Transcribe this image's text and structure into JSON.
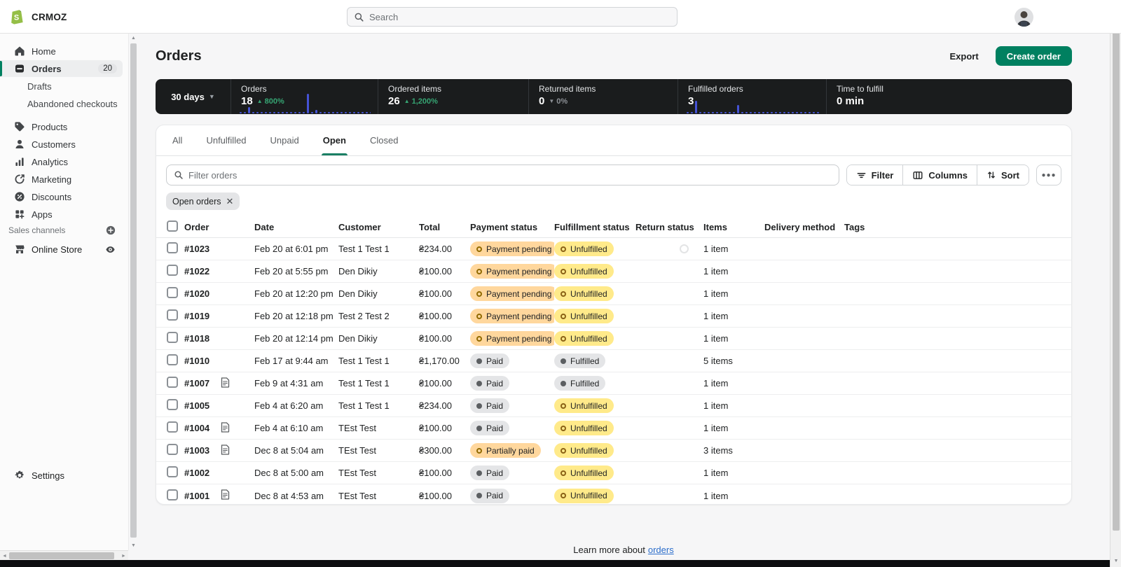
{
  "colors": {
    "accent_green": "#008060",
    "dark_panel": "#1a1c1d",
    "spark_blue": "#4553d6",
    "success_green": "#36a573",
    "link_blue": "#2c6ecb",
    "warning_bg": "#ffd79d",
    "attention_bg": "#ffea8a",
    "neutral_bg": "#e4e5e7"
  },
  "topbar": {
    "brand": "CRMOZ",
    "search_placeholder": "Search"
  },
  "sidebar": {
    "items": [
      {
        "label": "Home",
        "icon": "home-icon"
      },
      {
        "label": "Orders",
        "icon": "orders-icon",
        "badge": "20",
        "active": true
      },
      {
        "label": "Drafts",
        "indent": true
      },
      {
        "label": "Abandoned checkouts",
        "indent": true
      },
      {
        "label": "Products",
        "icon": "products-icon",
        "gap": true
      },
      {
        "label": "Customers",
        "icon": "customers-icon"
      },
      {
        "label": "Analytics",
        "icon": "analytics-icon"
      },
      {
        "label": "Marketing",
        "icon": "marketing-icon"
      },
      {
        "label": "Discounts",
        "icon": "discounts-icon"
      },
      {
        "label": "Apps",
        "icon": "apps-icon"
      }
    ],
    "sales_channels_label": "Sales channels",
    "online_store_label": "Online Store",
    "settings_label": "Settings"
  },
  "page": {
    "title": "Orders",
    "export_label": "Export",
    "create_order_label": "Create order",
    "footer_text": "Learn more about",
    "footer_link": "orders"
  },
  "stats": {
    "range": "30 days",
    "cards": [
      {
        "label": "Orders",
        "value": "18",
        "delta": "800%",
        "direction": "up",
        "spark": [
          2,
          2,
          9,
          2,
          2,
          2,
          2,
          2,
          2,
          2,
          2,
          2,
          2,
          2,
          2,
          2,
          28,
          2,
          5,
          2,
          2,
          2,
          2,
          2,
          2,
          2,
          2,
          2,
          2,
          2,
          2,
          2,
          2
        ]
      },
      {
        "label": "Ordered items",
        "value": "26",
        "delta": "1,200%",
        "direction": "up"
      },
      {
        "label": "Returned items",
        "value": "0",
        "delta": "0%",
        "direction": "down"
      },
      {
        "label": "Fulfilled orders",
        "value": "3",
        "spark": [
          2,
          2,
          18,
          2,
          2,
          2,
          2,
          2,
          2,
          2,
          2,
          2,
          12,
          2,
          2,
          2,
          2,
          2,
          2,
          2,
          2,
          2,
          2,
          2,
          2,
          2,
          2,
          2,
          2,
          2,
          2,
          2,
          2
        ]
      },
      {
        "label": "Time to fulfill",
        "value": "0 min"
      }
    ]
  },
  "tabs": {
    "items": [
      "All",
      "Unfulfilled",
      "Unpaid",
      "Open",
      "Closed"
    ],
    "active": "Open"
  },
  "toolbar": {
    "filter_placeholder": "Filter orders",
    "filter_label": "Filter",
    "columns_label": "Columns",
    "sort_label": "Sort",
    "chip_label": "Open orders"
  },
  "table": {
    "columns": [
      "Order",
      "Date",
      "Customer",
      "Total",
      "Payment status",
      "Fulfillment status",
      "Return status",
      "Items",
      "Delivery method",
      "Tags"
    ],
    "rows": [
      {
        "order": "#1023",
        "note": false,
        "date": "Feb 20 at 6:01 pm",
        "customer": "Test 1 Test 1",
        "total": "₴234.00",
        "payment": "Payment pending",
        "payment_type": "pending",
        "fulfillment": "Unfulfilled",
        "fulfillment_type": "unfulfilled",
        "items": "1 item",
        "spinner": true
      },
      {
        "order": "#1022",
        "note": false,
        "date": "Feb 20 at 5:55 pm",
        "customer": "Den Dikiy",
        "total": "₴100.00",
        "payment": "Payment pending",
        "payment_type": "pending",
        "fulfillment": "Unfulfilled",
        "fulfillment_type": "unfulfilled",
        "items": "1 item"
      },
      {
        "order": "#1020",
        "note": false,
        "date": "Feb 20 at 12:20 pm",
        "customer": "Den Dikiy",
        "total": "₴100.00",
        "payment": "Payment pending",
        "payment_type": "pending",
        "fulfillment": "Unfulfilled",
        "fulfillment_type": "unfulfilled",
        "items": "1 item"
      },
      {
        "order": "#1019",
        "note": false,
        "date": "Feb 20 at 12:18 pm",
        "customer": "Test 2 Test 2",
        "total": "₴100.00",
        "payment": "Payment pending",
        "payment_type": "pending",
        "fulfillment": "Unfulfilled",
        "fulfillment_type": "unfulfilled",
        "items": "1 item"
      },
      {
        "order": "#1018",
        "note": false,
        "date": "Feb 20 at 12:14 pm",
        "customer": "Den Dikiy",
        "total": "₴100.00",
        "payment": "Payment pending",
        "payment_type": "pending",
        "fulfillment": "Unfulfilled",
        "fulfillment_type": "unfulfilled",
        "items": "1 item"
      },
      {
        "order": "#1010",
        "note": false,
        "date": "Feb 17 at 9:44 am",
        "customer": "Test 1 Test 1",
        "total": "₴1,170.00",
        "payment": "Paid",
        "payment_type": "paid",
        "fulfillment": "Fulfilled",
        "fulfillment_type": "fulfilled",
        "items": "5 items"
      },
      {
        "order": "#1007",
        "note": true,
        "date": "Feb 9 at 4:31 am",
        "customer": "Test 1 Test 1",
        "total": "₴100.00",
        "payment": "Paid",
        "payment_type": "paid",
        "fulfillment": "Fulfilled",
        "fulfillment_type": "fulfilled",
        "items": "1 item"
      },
      {
        "order": "#1005",
        "note": false,
        "date": "Feb 4 at 6:20 am",
        "customer": "Test 1 Test 1",
        "total": "₴234.00",
        "payment": "Paid",
        "payment_type": "paid",
        "fulfillment": "Unfulfilled",
        "fulfillment_type": "unfulfilled",
        "items": "1 item"
      },
      {
        "order": "#1004",
        "note": true,
        "date": "Feb 4 at 6:10 am",
        "customer": "TEst Test",
        "total": "₴100.00",
        "payment": "Paid",
        "payment_type": "paid",
        "fulfillment": "Unfulfilled",
        "fulfillment_type": "unfulfilled",
        "items": "1 item"
      },
      {
        "order": "#1003",
        "note": true,
        "date": "Dec 8 at 5:04 am",
        "customer": "TEst Test",
        "total": "₴300.00",
        "payment": "Partially paid",
        "payment_type": "partial",
        "fulfillment": "Unfulfilled",
        "fulfillment_type": "unfulfilled",
        "items": "3 items"
      },
      {
        "order": "#1002",
        "note": false,
        "date": "Dec 8 at 5:00 am",
        "customer": "TEst Test",
        "total": "₴100.00",
        "payment": "Paid",
        "payment_type": "paid",
        "fulfillment": "Unfulfilled",
        "fulfillment_type": "unfulfilled",
        "items": "1 item"
      },
      {
        "order": "#1001",
        "note": true,
        "date": "Dec 8 at 4:53 am",
        "customer": "TEst Test",
        "total": "₴100.00",
        "payment": "Paid",
        "payment_type": "paid",
        "fulfillment": "Unfulfilled",
        "fulfillment_type": "unfulfilled",
        "items": "1 item"
      }
    ]
  }
}
